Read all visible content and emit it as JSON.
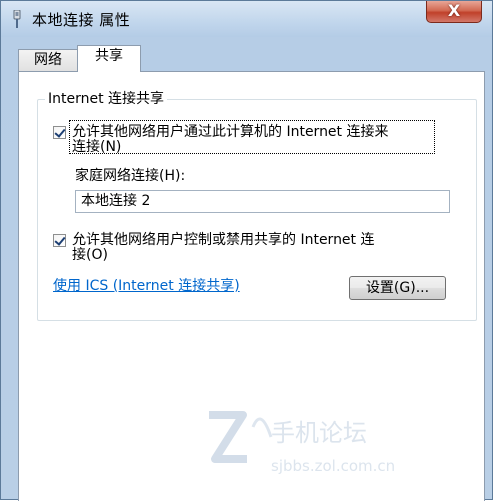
{
  "window": {
    "title": "本地连接 属性",
    "close_label": "X"
  },
  "tabs": [
    {
      "label": "网络",
      "selected": false
    },
    {
      "label": "共享",
      "selected": true
    }
  ],
  "sharing": {
    "group_title": "Internet 连接共享",
    "allow_connect_line1": "允许其他网络用户通过此计算机的 Internet 连接来",
    "allow_connect_line2": "连接(N)",
    "allow_connect_checked": true,
    "home_network_label": "家庭网络连接(H):",
    "home_network_value": "本地连接 2",
    "allow_control_line1": "允许其他网络用户控制或禁用共享的 Internet 连",
    "allow_control_line2": "接(O)",
    "allow_control_checked": true,
    "ics_link": "使用 ICS (Internet 连接共享)",
    "settings_button": "设置(G)..."
  },
  "watermark": {
    "text_cn": "手机论坛",
    "text_url": "sjbbs.zol.com.cn"
  },
  "colors": {
    "link": "#0066cc",
    "close_button": "#c0402a",
    "title_bar": "#c1d6ec"
  }
}
